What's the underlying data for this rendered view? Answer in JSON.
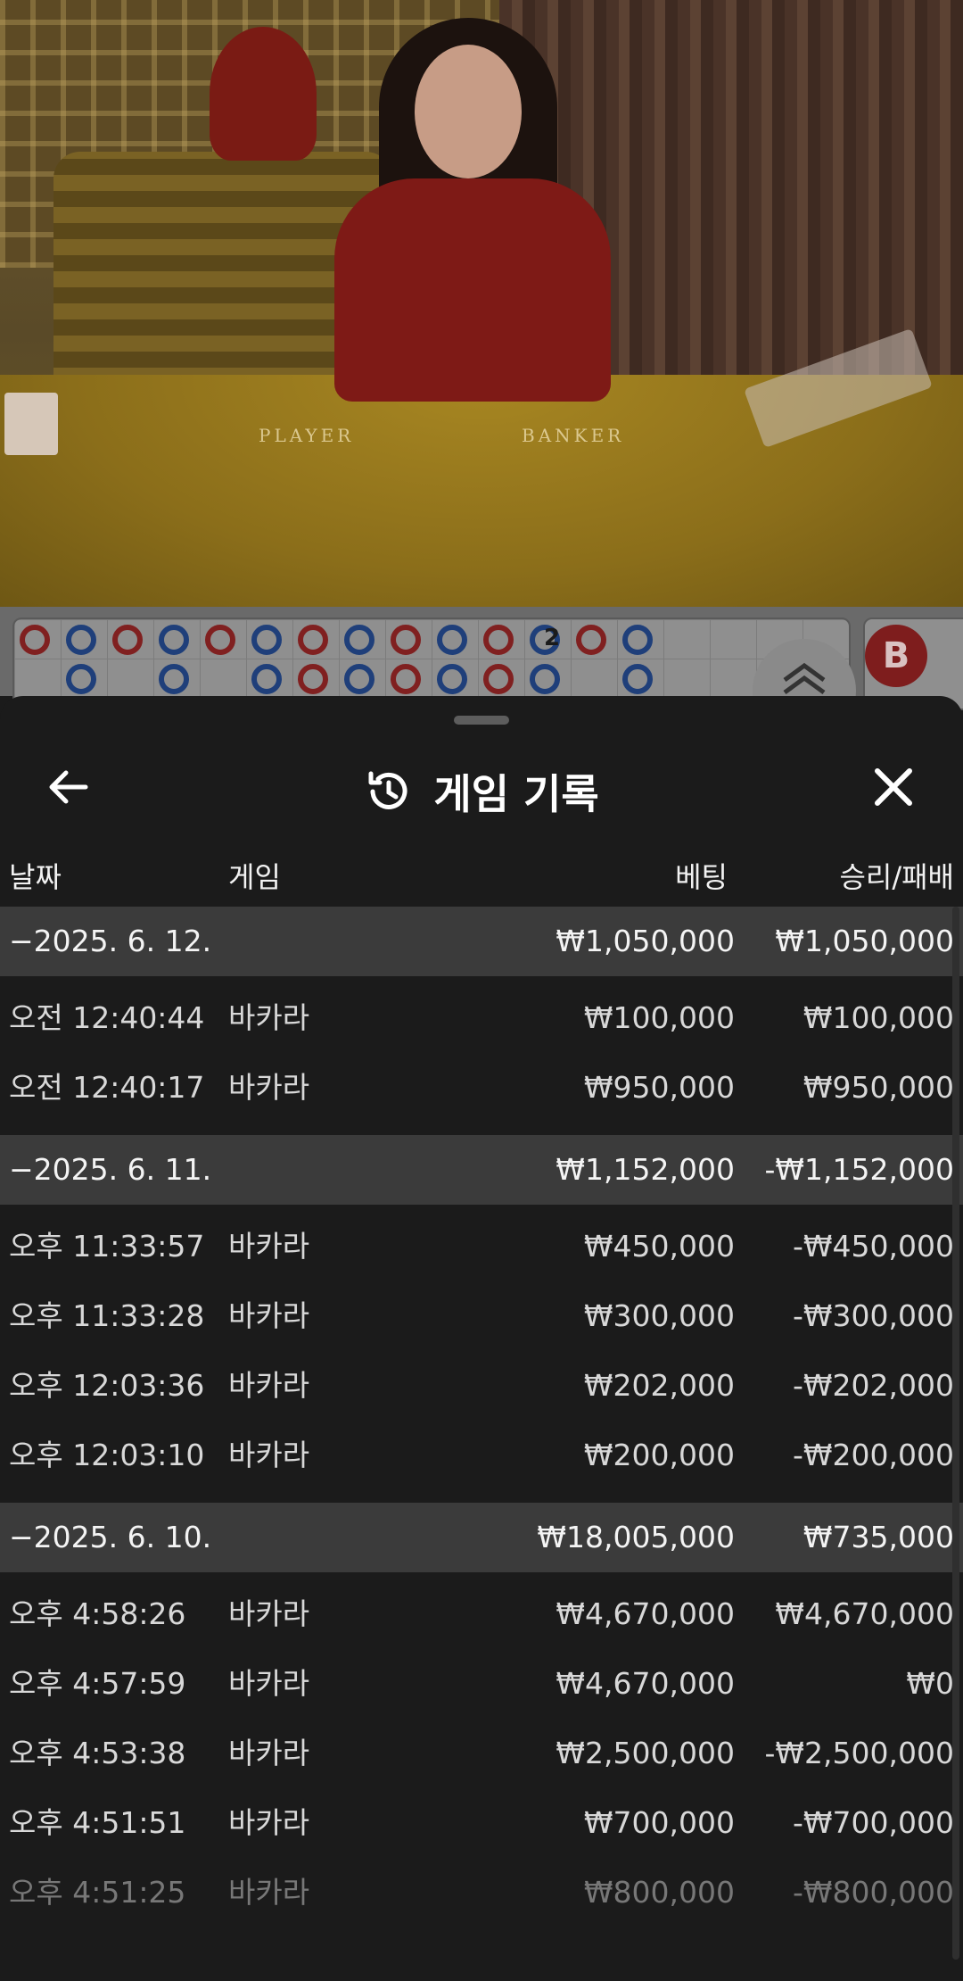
{
  "video": {
    "table_labels": {
      "player": "PLAYER",
      "banker": "BANKER"
    }
  },
  "bead_road": {
    "marker_number": "2",
    "banker_badge": "B"
  },
  "sheet": {
    "title": "게임 기록",
    "columns": {
      "date": "날짜",
      "game": "게임",
      "bet": "베팅",
      "win_loss": "승리/패배"
    },
    "groups": [
      {
        "date": "−2025. 6. 12.",
        "bet": "₩1,050,000",
        "win_loss": "₩1,050,000",
        "rows": [
          {
            "time": "오전 12:40:44",
            "game": "바카라",
            "bet": "₩100,000",
            "win_loss": "₩100,000"
          },
          {
            "time": "오전 12:40:17",
            "game": "바카라",
            "bet": "₩950,000",
            "win_loss": "₩950,000"
          }
        ]
      },
      {
        "date": "−2025. 6. 11.",
        "bet": "₩1,152,000",
        "win_loss": "-₩1,152,000",
        "rows": [
          {
            "time": "오후 11:33:57",
            "game": "바카라",
            "bet": "₩450,000",
            "win_loss": "-₩450,000"
          },
          {
            "time": "오후 11:33:28",
            "game": "바카라",
            "bet": "₩300,000",
            "win_loss": "-₩300,000"
          },
          {
            "time": "오후 12:03:36",
            "game": "바카라",
            "bet": "₩202,000",
            "win_loss": "-₩202,000"
          },
          {
            "time": "오후 12:03:10",
            "game": "바카라",
            "bet": "₩200,000",
            "win_loss": "-₩200,000"
          }
        ]
      },
      {
        "date": "−2025. 6. 10.",
        "bet": "₩18,005,000",
        "win_loss": "₩735,000",
        "rows": [
          {
            "time": "오후 4:58:26",
            "game": "바카라",
            "bet": "₩4,670,000",
            "win_loss": "₩4,670,000"
          },
          {
            "time": "오후 4:57:59",
            "game": "바카라",
            "bet": "₩4,670,000",
            "win_loss": "₩0"
          },
          {
            "time": "오후 4:53:38",
            "game": "바카라",
            "bet": "₩2,500,000",
            "win_loss": "-₩2,500,000"
          },
          {
            "time": "오후 4:51:51",
            "game": "바카라",
            "bet": "₩700,000",
            "win_loss": "-₩700,000"
          },
          {
            "time": "오후 4:51:25",
            "game": "바카라",
            "bet": "₩800,000",
            "win_loss": "-₩800,000"
          }
        ]
      }
    ]
  }
}
